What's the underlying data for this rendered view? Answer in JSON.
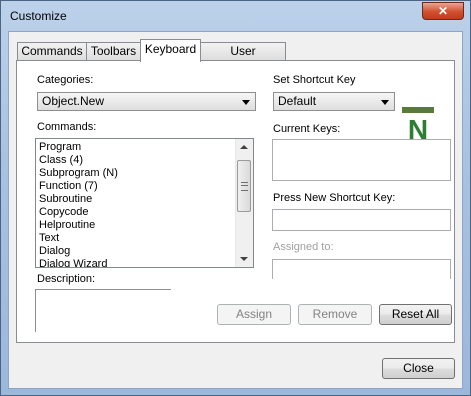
{
  "window": {
    "title": "Customize",
    "close_glyph": "✕"
  },
  "tabs": [
    {
      "label": "Commands"
    },
    {
      "label": "Toolbars"
    },
    {
      "label": "Keyboard",
      "active": true
    },
    {
      "label": "User Commands"
    }
  ],
  "categories": {
    "label": "Categories:",
    "value": "Object.New"
  },
  "commands": {
    "label": "Commands:",
    "items": [
      "Program",
      "Class (4)",
      "Subprogram (N)",
      "Function (7)",
      "Subroutine",
      "Copycode",
      "Helproutine",
      "Text",
      "Dialog",
      "Dialog Wizard"
    ]
  },
  "description": {
    "label": "Description:"
  },
  "shortcut_set": {
    "label": "Set Shortcut Key",
    "value": "Default"
  },
  "current_keys": {
    "label": "Current Keys:"
  },
  "new_shortcut": {
    "label": "Press New Shortcut Key:",
    "value": ""
  },
  "assigned_to": {
    "label": "Assigned to:"
  },
  "buttons": {
    "assign": "Assign",
    "remove": "Remove",
    "reset_all": "Reset All",
    "close": "Close"
  },
  "logo": {
    "letter": "N",
    "colors": {
      "bar": "#5a7a3a",
      "letter": "#2e7d32"
    }
  }
}
